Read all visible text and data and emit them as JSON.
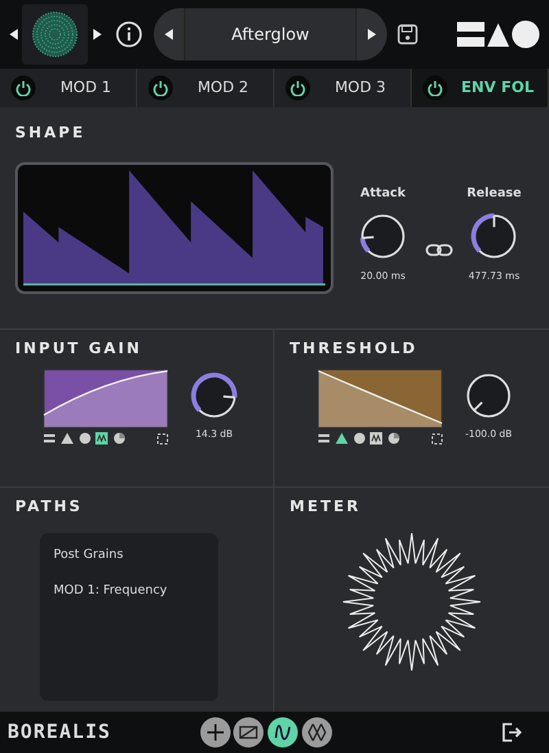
{
  "header": {
    "preset_name": "Afterglow"
  },
  "mod_tabs": [
    {
      "label": "MOD 1",
      "on": true,
      "selected": false
    },
    {
      "label": "MOD 2",
      "on": true,
      "selected": false
    },
    {
      "label": "MOD 3",
      "on": true,
      "selected": false
    },
    {
      "label": "ENV FOL",
      "on": true,
      "selected": true
    }
  ],
  "shape": {
    "title": "SHAPE",
    "knobs": [
      {
        "label": "Attack",
        "reading": "20.00 ms"
      },
      {
        "label": "Release",
        "reading": "477.73 ms"
      }
    ]
  },
  "curves": [
    {
      "title": "INPUT GAIN",
      "color": "#7a4fa6",
      "reading": "14.3 dB",
      "rising": true,
      "shapes": [
        {
          "kind": "lines",
          "selected": false
        },
        {
          "kind": "triangle",
          "selected": false
        },
        {
          "kind": "circle",
          "selected": false
        },
        {
          "kind": "wave",
          "selected": true
        },
        {
          "kind": "half",
          "selected": false
        }
      ]
    },
    {
      "title": "THRESHOLD",
      "color": "#8a6634",
      "reading": "-100.0 dB",
      "rising": false,
      "shapes": [
        {
          "kind": "lines",
          "selected": false
        },
        {
          "kind": "triangle",
          "selected": true
        },
        {
          "kind": "circle",
          "selected": false
        },
        {
          "kind": "wave",
          "selected": false
        },
        {
          "kind": "half",
          "selected": false
        }
      ]
    }
  ],
  "paths": {
    "title": "PATHS",
    "items": [
      "Post Grains",
      "MOD 1: Frequency"
    ]
  },
  "meter": {
    "title": "METER"
  },
  "footer": {
    "logo": "BOREALIS",
    "modes": [
      {
        "kind": "plus",
        "selected": false
      },
      {
        "kind": "ramp",
        "selected": false
      },
      {
        "kind": "wave",
        "selected": true
      },
      {
        "kind": "cross",
        "selected": false
      }
    ]
  }
}
